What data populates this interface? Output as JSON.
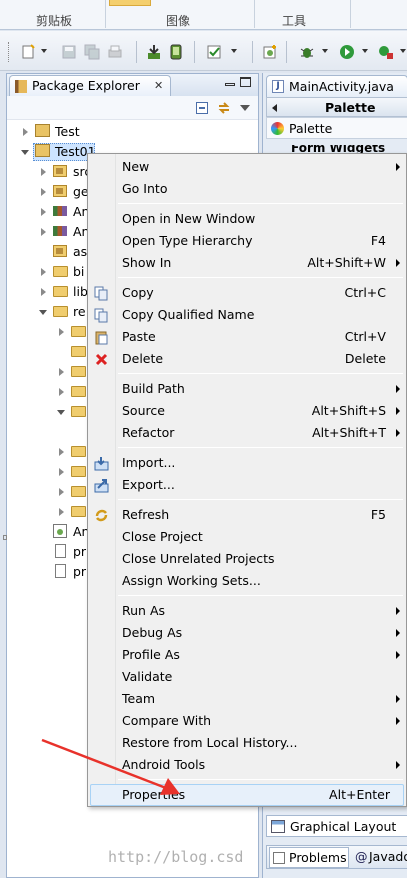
{
  "ribbon": {
    "groups": [
      "剪贴板",
      "图像",
      "工具"
    ]
  },
  "package_explorer": {
    "title": "Package Explorer",
    "close_glyph": "✕",
    "tree": [
      {
        "label": "Test"
      },
      {
        "label": "Test01",
        "selected": true
      },
      {
        "label": "src"
      },
      {
        "label": "gen"
      },
      {
        "label": "An"
      },
      {
        "label": "An"
      },
      {
        "label": "as"
      },
      {
        "label": "bi"
      },
      {
        "label": "lib"
      },
      {
        "label": "re"
      },
      {
        "label": "An"
      },
      {
        "label": "pr"
      },
      {
        "label": "pr"
      }
    ]
  },
  "right_panel": {
    "editor_tab": "MainActivity.java",
    "palette_header": "Palette",
    "palette_item": "Palette",
    "form_widgets": "Form Widgets",
    "graphical_layout": "Graphical Layout",
    "problems": "Problems",
    "javadoc": "Javado"
  },
  "context_menu": {
    "items": [
      {
        "label": "New",
        "submenu": true
      },
      {
        "label": "Go Into"
      },
      {
        "label": "Open in New Window"
      },
      {
        "label": "Open Type Hierarchy",
        "shortcut": "F4"
      },
      {
        "label": "Show In",
        "shortcut": "Alt+Shift+W",
        "submenu": true
      },
      {
        "label": "Copy",
        "shortcut": "Ctrl+C",
        "icon": "copy-icon"
      },
      {
        "label": "Copy Qualified Name",
        "icon": "copy-qualified-icon"
      },
      {
        "label": "Paste",
        "shortcut": "Ctrl+V",
        "icon": "paste-icon"
      },
      {
        "label": "Delete",
        "shortcut": "Delete",
        "icon": "delete-icon"
      },
      {
        "label": "Build Path",
        "submenu": true
      },
      {
        "label": "Source",
        "shortcut": "Alt+Shift+S",
        "submenu": true
      },
      {
        "label": "Refactor",
        "shortcut": "Alt+Shift+T",
        "submenu": true
      },
      {
        "label": "Import...",
        "icon": "import-icon"
      },
      {
        "label": "Export...",
        "icon": "export-icon"
      },
      {
        "label": "Refresh",
        "shortcut": "F5",
        "icon": "refresh-icon"
      },
      {
        "label": "Close Project"
      },
      {
        "label": "Close Unrelated Projects"
      },
      {
        "label": "Assign Working Sets..."
      },
      {
        "label": "Run As",
        "submenu": true
      },
      {
        "label": "Debug As",
        "submenu": true
      },
      {
        "label": "Profile As",
        "submenu": true
      },
      {
        "label": "Validate"
      },
      {
        "label": "Team",
        "submenu": true
      },
      {
        "label": "Compare With",
        "submenu": true
      },
      {
        "label": "Restore from Local History..."
      },
      {
        "label": "Android Tools",
        "submenu": true
      },
      {
        "label": "Properties",
        "shortcut": "Alt+Enter",
        "highlighted": true
      }
    ]
  },
  "watermark": "http://blog.csd",
  "colors": {
    "accent": "#3399ff",
    "arrow": "#e8322b",
    "selection": "#cde4ff"
  }
}
